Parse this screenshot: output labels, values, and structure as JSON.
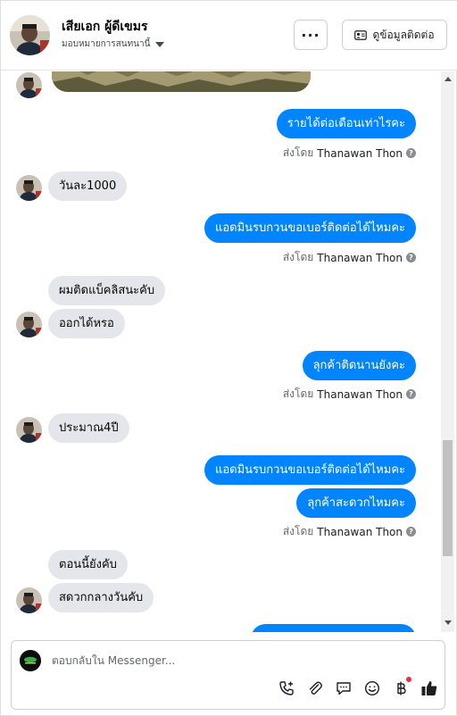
{
  "header": {
    "name": "เสียเอก ผู้ดีเขมร",
    "assign_label": "มอบหมายการสนทนานี้",
    "more_label": "···",
    "contact_button_label": "ดูข้อมูลติดต่อ"
  },
  "messages": [
    {
      "direction": "out",
      "text": "รายได้ต่อเดือนเท่าไรคะ"
    },
    {
      "direction": "sentby",
      "prefix": "ส่งโดย",
      "sender": "Thanawan Thon"
    },
    {
      "direction": "in",
      "text": "วันละ1000"
    },
    {
      "direction": "out",
      "text": "แอดมินรบกวนขอเบอร์ติดต่อได้ไหมคะ"
    },
    {
      "direction": "sentby",
      "prefix": "ส่งโดย",
      "sender": "Thanawan Thon"
    },
    {
      "direction": "in",
      "text": "ผมติดแบ็คลิสนะคับ"
    },
    {
      "direction": "in",
      "text": "ออกได้หรอ"
    },
    {
      "direction": "out",
      "text": "ลุกค้าติดนานยังคะ"
    },
    {
      "direction": "sentby",
      "prefix": "ส่งโดย",
      "sender": "Thanawan Thon"
    },
    {
      "direction": "in",
      "text": "ประมาณ4ปี"
    },
    {
      "direction": "out",
      "text": "แอดมินรบกวนขอเบอร์ติดต่อได้ไหมคะ"
    },
    {
      "direction": "out",
      "text": "ลุกค้าสะดวกไหมคะ"
    },
    {
      "direction": "sentby",
      "prefix": "ส่งโดย",
      "sender": "Thanawan Thon"
    },
    {
      "direction": "in",
      "text": "ตอนนี้ยังคับ"
    },
    {
      "direction": "in",
      "text": "สดวกกลางวันคับ"
    }
  ],
  "composer": {
    "placeholder": "ตอบกลับใน Messenger..."
  },
  "colors": {
    "outgoing_bubble": "#0084ff",
    "incoming_bubble": "#e4e6eb",
    "notification_dot": "#f02849"
  },
  "icons": [
    "more-icon",
    "contact-card-icon",
    "caret-down-icon",
    "help-icon",
    "call-icon",
    "attachment-icon",
    "saved-reply-icon",
    "emoji-icon",
    "baht-payment-icon",
    "like-icon"
  ]
}
